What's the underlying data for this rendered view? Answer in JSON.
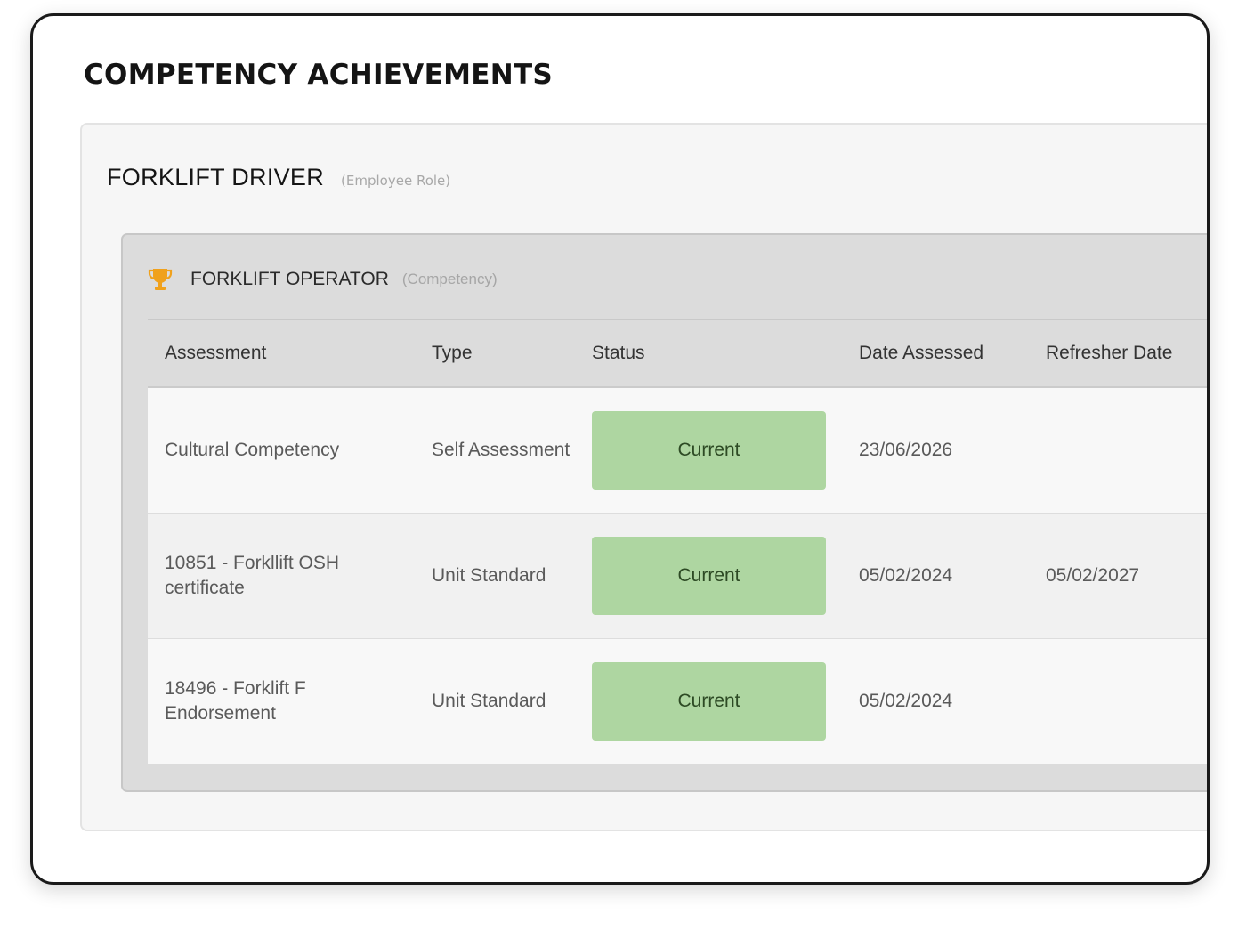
{
  "page_title": "COMPETENCY ACHIEVEMENTS",
  "role": {
    "title": "FORKLIFT DRIVER",
    "subtitle": "(Employee Role)"
  },
  "competency": {
    "title": "FORKLIFT OPERATOR",
    "subtitle": "(Competency)",
    "icon": "trophy-icon",
    "icon_color": "#f0a11c"
  },
  "table": {
    "headers": [
      "Assessment",
      "Type",
      "Status",
      "Date Assessed",
      "Refresher Date"
    ],
    "rows": [
      {
        "assessment": "Cultural Competency",
        "type": "Self Assessment",
        "status": "Current",
        "date_assessed": "23/06/2026",
        "refresher_date": ""
      },
      {
        "assessment": "10851 - Forkllift OSH certificate",
        "type": "Unit Standard",
        "status": "Current",
        "date_assessed": "05/02/2024",
        "refresher_date": "05/02/2027"
      },
      {
        "assessment": "18496 - Forklift F Endorsement",
        "type": "Unit Standard",
        "status": "Current",
        "date_assessed": "05/02/2024",
        "refresher_date": ""
      }
    ]
  },
  "colors": {
    "status_current_bg": "#aed6a1",
    "status_current_text": "#2d4a24"
  }
}
